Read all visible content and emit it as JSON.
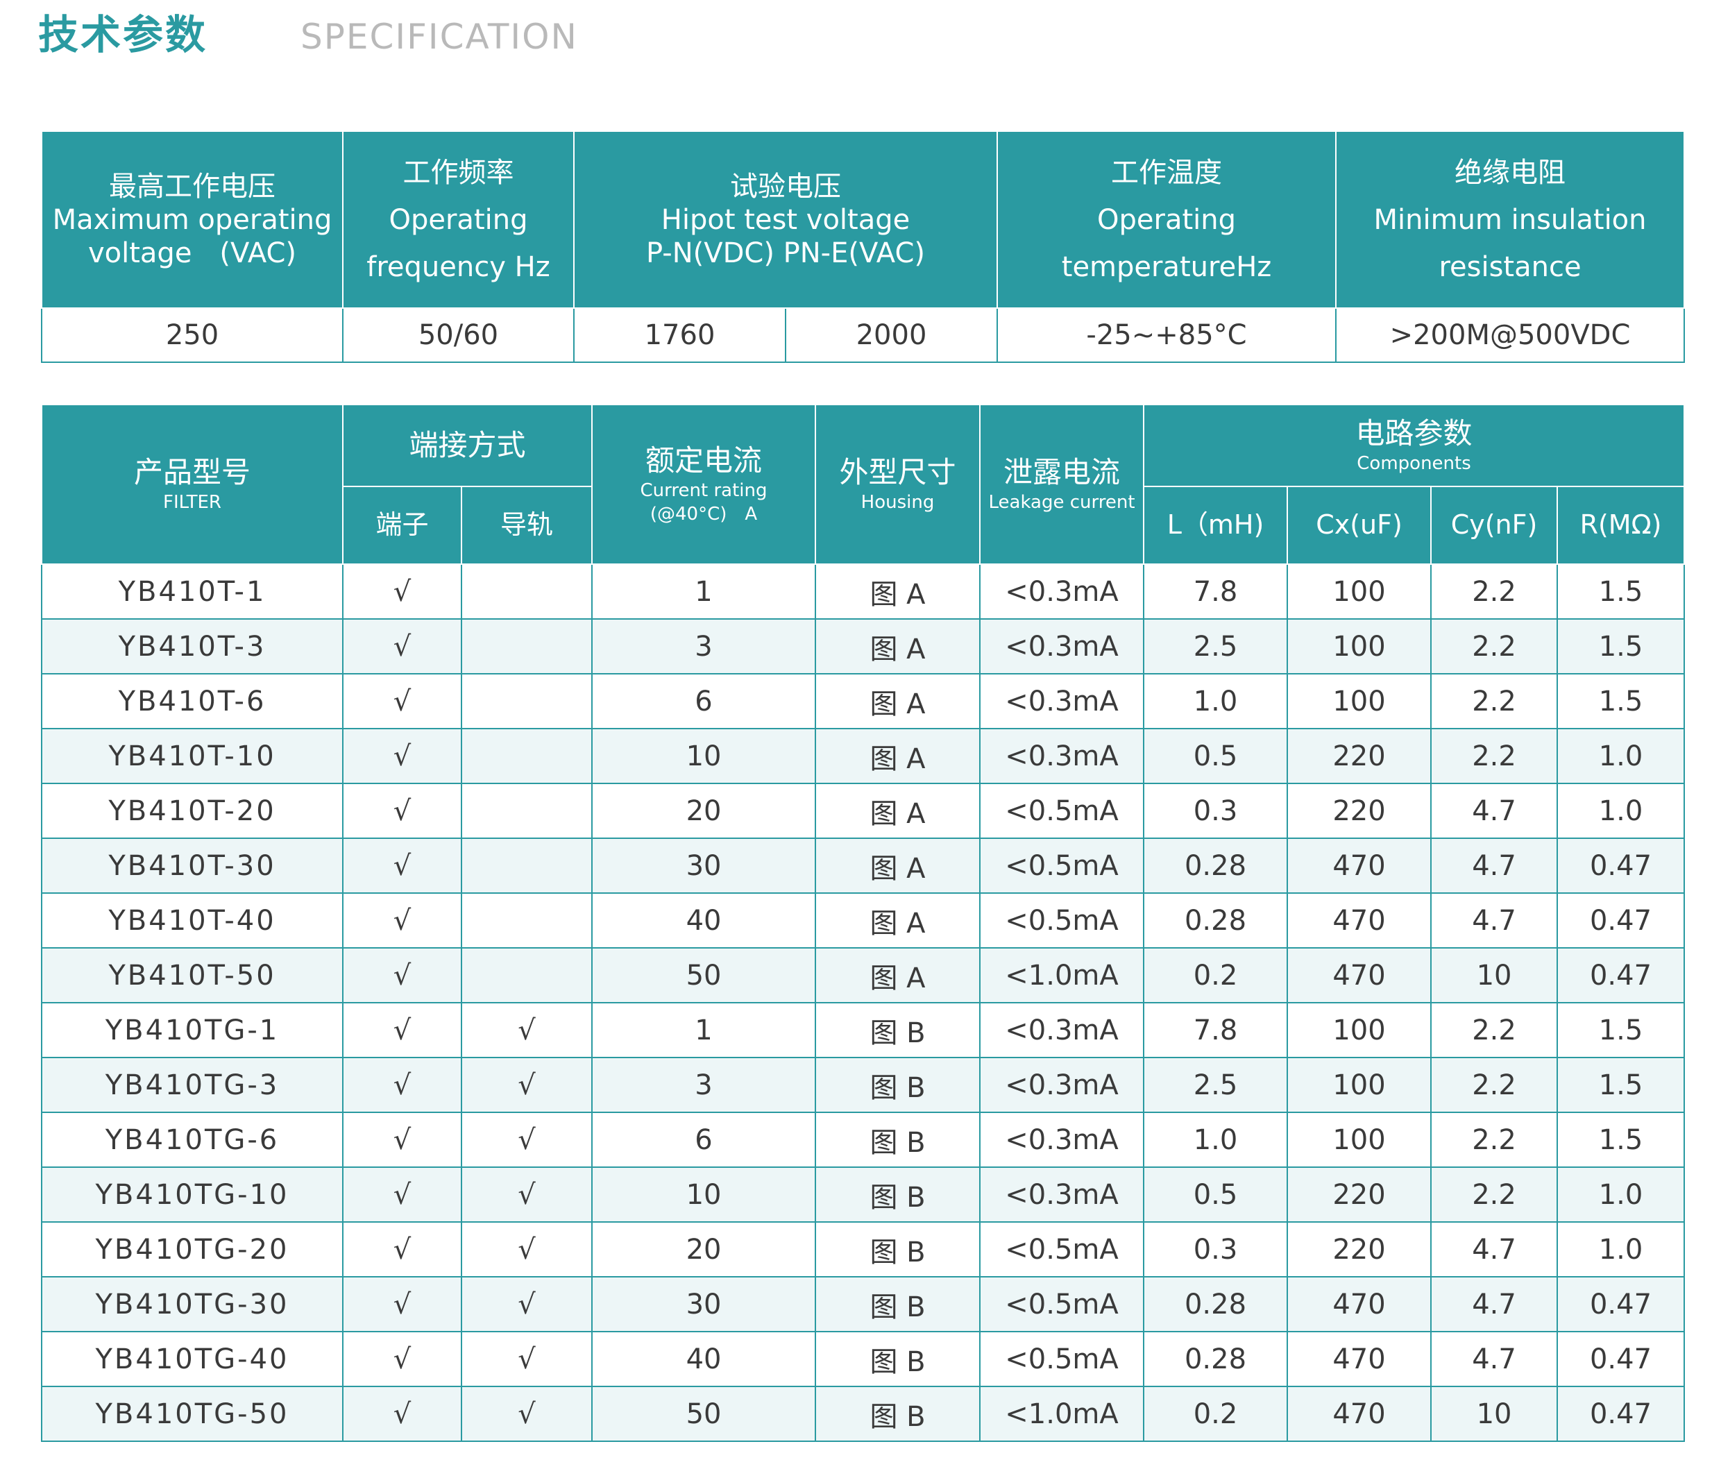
{
  "header": {
    "title_cn": "技术参数",
    "title_en": "SPECIFICATION"
  },
  "spec_table": {
    "headers": {
      "max_voltage": [
        "最高工作电压",
        "Maximum operating",
        "voltage　(VAC)"
      ],
      "frequency": [
        "工作频率",
        "Operating",
        "frequency Hz"
      ],
      "hipot": [
        "试验电压",
        "Hipot test voltage",
        "P-N(VDC)",
        "PN-E(VAC)"
      ],
      "temperature": [
        "工作温度",
        "Operating",
        "temperatureHz"
      ],
      "insulation": [
        "绝缘电阻",
        "Minimum insulation",
        "resistance"
      ]
    },
    "values": {
      "max_voltage": "250",
      "frequency": "50/60",
      "hipot_pn": "1760",
      "hipot_pne": "2000",
      "temperature": "-25~+85°C",
      "insulation": ">200M@500VDC"
    }
  },
  "product_table": {
    "headers": {
      "model_cn": "产品型号",
      "model_en": "FILTER",
      "connection": "端接方式",
      "terminal": "端子",
      "rail": "导轨",
      "current_cn": "额定电流",
      "current_en1": "Current rating",
      "current_en2": "(@40°C)　A",
      "housing_cn": "外型尺寸",
      "housing_en": "Housing",
      "leakage_cn": "泄露电流",
      "leakage_en": "Leakage current",
      "circuit_cn": "电路参数",
      "circuit_en": "Components",
      "l": "L（mH)",
      "cx": "Cx(uF)",
      "cy": "Cy(nF)",
      "r": "R(MΩ)"
    },
    "rows": [
      {
        "model": "YB410T-1",
        "terminal": "√",
        "rail": "",
        "current": "1",
        "housing": "图 A",
        "leakage": "<0.3mA",
        "l": "7.8",
        "cx": "100",
        "cy": "2.2",
        "r": "1.5"
      },
      {
        "model": "YB410T-3",
        "terminal": "√",
        "rail": "",
        "current": "3",
        "housing": "图 A",
        "leakage": "<0.3mA",
        "l": "2.5",
        "cx": "100",
        "cy": "2.2",
        "r": "1.5"
      },
      {
        "model": "YB410T-6",
        "terminal": "√",
        "rail": "",
        "current": "6",
        "housing": "图 A",
        "leakage": "<0.3mA",
        "l": "1.0",
        "cx": "100",
        "cy": "2.2",
        "r": "1.5"
      },
      {
        "model": "YB410T-10",
        "terminal": "√",
        "rail": "",
        "current": "10",
        "housing": "图 A",
        "leakage": "<0.3mA",
        "l": "0.5",
        "cx": "220",
        "cy": "2.2",
        "r": "1.0"
      },
      {
        "model": "YB410T-20",
        "terminal": "√",
        "rail": "",
        "current": "20",
        "housing": "图 A",
        "leakage": "<0.5mA",
        "l": "0.3",
        "cx": "220",
        "cy": "4.7",
        "r": "1.0"
      },
      {
        "model": "YB410T-30",
        "terminal": "√",
        "rail": "",
        "current": "30",
        "housing": "图 A",
        "leakage": "<0.5mA",
        "l": "0.28",
        "cx": "470",
        "cy": "4.7",
        "r": "0.47"
      },
      {
        "model": "YB410T-40",
        "terminal": "√",
        "rail": "",
        "current": "40",
        "housing": "图 A",
        "leakage": "<0.5mA",
        "l": "0.28",
        "cx": "470",
        "cy": "4.7",
        "r": "0.47"
      },
      {
        "model": "YB410T-50",
        "terminal": "√",
        "rail": "",
        "current": "50",
        "housing": "图 A",
        "leakage": "<1.0mA",
        "l": "0.2",
        "cx": "470",
        "cy": "10",
        "r": "0.47"
      },
      {
        "model": "YB410TG-1",
        "terminal": "√",
        "rail": "√",
        "current": "1",
        "housing": "图 B",
        "leakage": "<0.3mA",
        "l": "7.8",
        "cx": "100",
        "cy": "2.2",
        "r": "1.5"
      },
      {
        "model": "YB410TG-3",
        "terminal": "√",
        "rail": "√",
        "current": "3",
        "housing": "图 B",
        "leakage": "<0.3mA",
        "l": "2.5",
        "cx": "100",
        "cy": "2.2",
        "r": "1.5"
      },
      {
        "model": "YB410TG-6",
        "terminal": "√",
        "rail": "√",
        "current": "6",
        "housing": "图 B",
        "leakage": "<0.3mA",
        "l": "1.0",
        "cx": "100",
        "cy": "2.2",
        "r": "1.5"
      },
      {
        "model": "YB410TG-10",
        "terminal": "√",
        "rail": "√",
        "current": "10",
        "housing": "图 B",
        "leakage": "<0.3mA",
        "l": "0.5",
        "cx": "220",
        "cy": "2.2",
        "r": "1.0"
      },
      {
        "model": "YB410TG-20",
        "terminal": "√",
        "rail": "√",
        "current": "20",
        "housing": "图 B",
        "leakage": "<0.5mA",
        "l": "0.3",
        "cx": "220",
        "cy": "4.7",
        "r": "1.0"
      },
      {
        "model": "YB410TG-30",
        "terminal": "√",
        "rail": "√",
        "current": "30",
        "housing": "图 B",
        "leakage": "<0.5mA",
        "l": "0.28",
        "cx": "470",
        "cy": "4.7",
        "r": "0.47"
      },
      {
        "model": "YB410TG-40",
        "terminal": "√",
        "rail": "√",
        "current": "40",
        "housing": "图 B",
        "leakage": "<0.5mA",
        "l": "0.28",
        "cx": "470",
        "cy": "4.7",
        "r": "0.47"
      },
      {
        "model": "YB410TG-50",
        "terminal": "√",
        "rail": "√",
        "current": "50",
        "housing": "图 B",
        "leakage": "<1.0mA",
        "l": "0.2",
        "cx": "470",
        "cy": "10",
        "r": "0.47"
      }
    ]
  }
}
